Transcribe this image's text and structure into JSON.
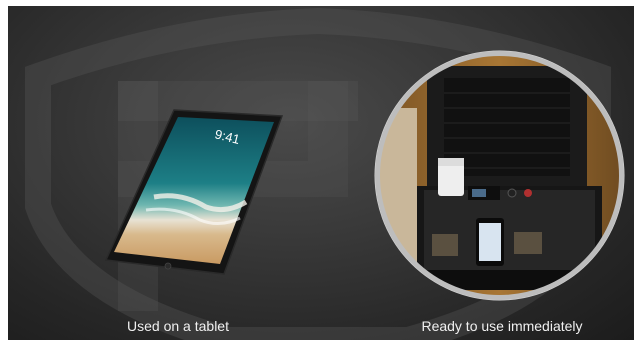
{
  "tablet": {
    "clock_time": "9:41"
  },
  "captions": {
    "left": "Used on a tablet",
    "right": "Ready to use immediately"
  }
}
